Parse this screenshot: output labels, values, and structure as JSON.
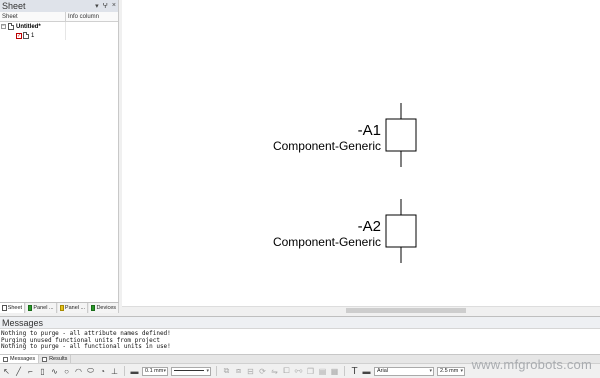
{
  "sheet_panel": {
    "title": "Sheet",
    "pin_icon": "pin-icon",
    "close_icon": "close-icon",
    "columns": [
      "Sheet",
      "Info column"
    ],
    "tree": {
      "project": {
        "label": "Untitled*",
        "expander": "−"
      },
      "sheet": {
        "label": "1"
      }
    },
    "tabs": [
      "Sheet",
      "Panel ...",
      "Panel ...",
      "Devices"
    ]
  },
  "canvas": {
    "components": [
      {
        "tag": "-A1",
        "name": "Component-Generic"
      },
      {
        "tag": "-A2",
        "name": "Component-Generic"
      }
    ]
  },
  "messages": {
    "title": "Messages",
    "lines": [
      "Nothing to purge - all attribute names defined!",
      "Purging unused functional units from project",
      "Nothing to purge - all functional units in use!"
    ],
    "tabs": [
      "Messages",
      "Results"
    ]
  },
  "toolbar": {
    "line_width": "0.1 mm",
    "font": "Arial",
    "font_size": "2.5 mm",
    "text_tool": "T"
  },
  "watermark": "www.mfgrobots.com"
}
